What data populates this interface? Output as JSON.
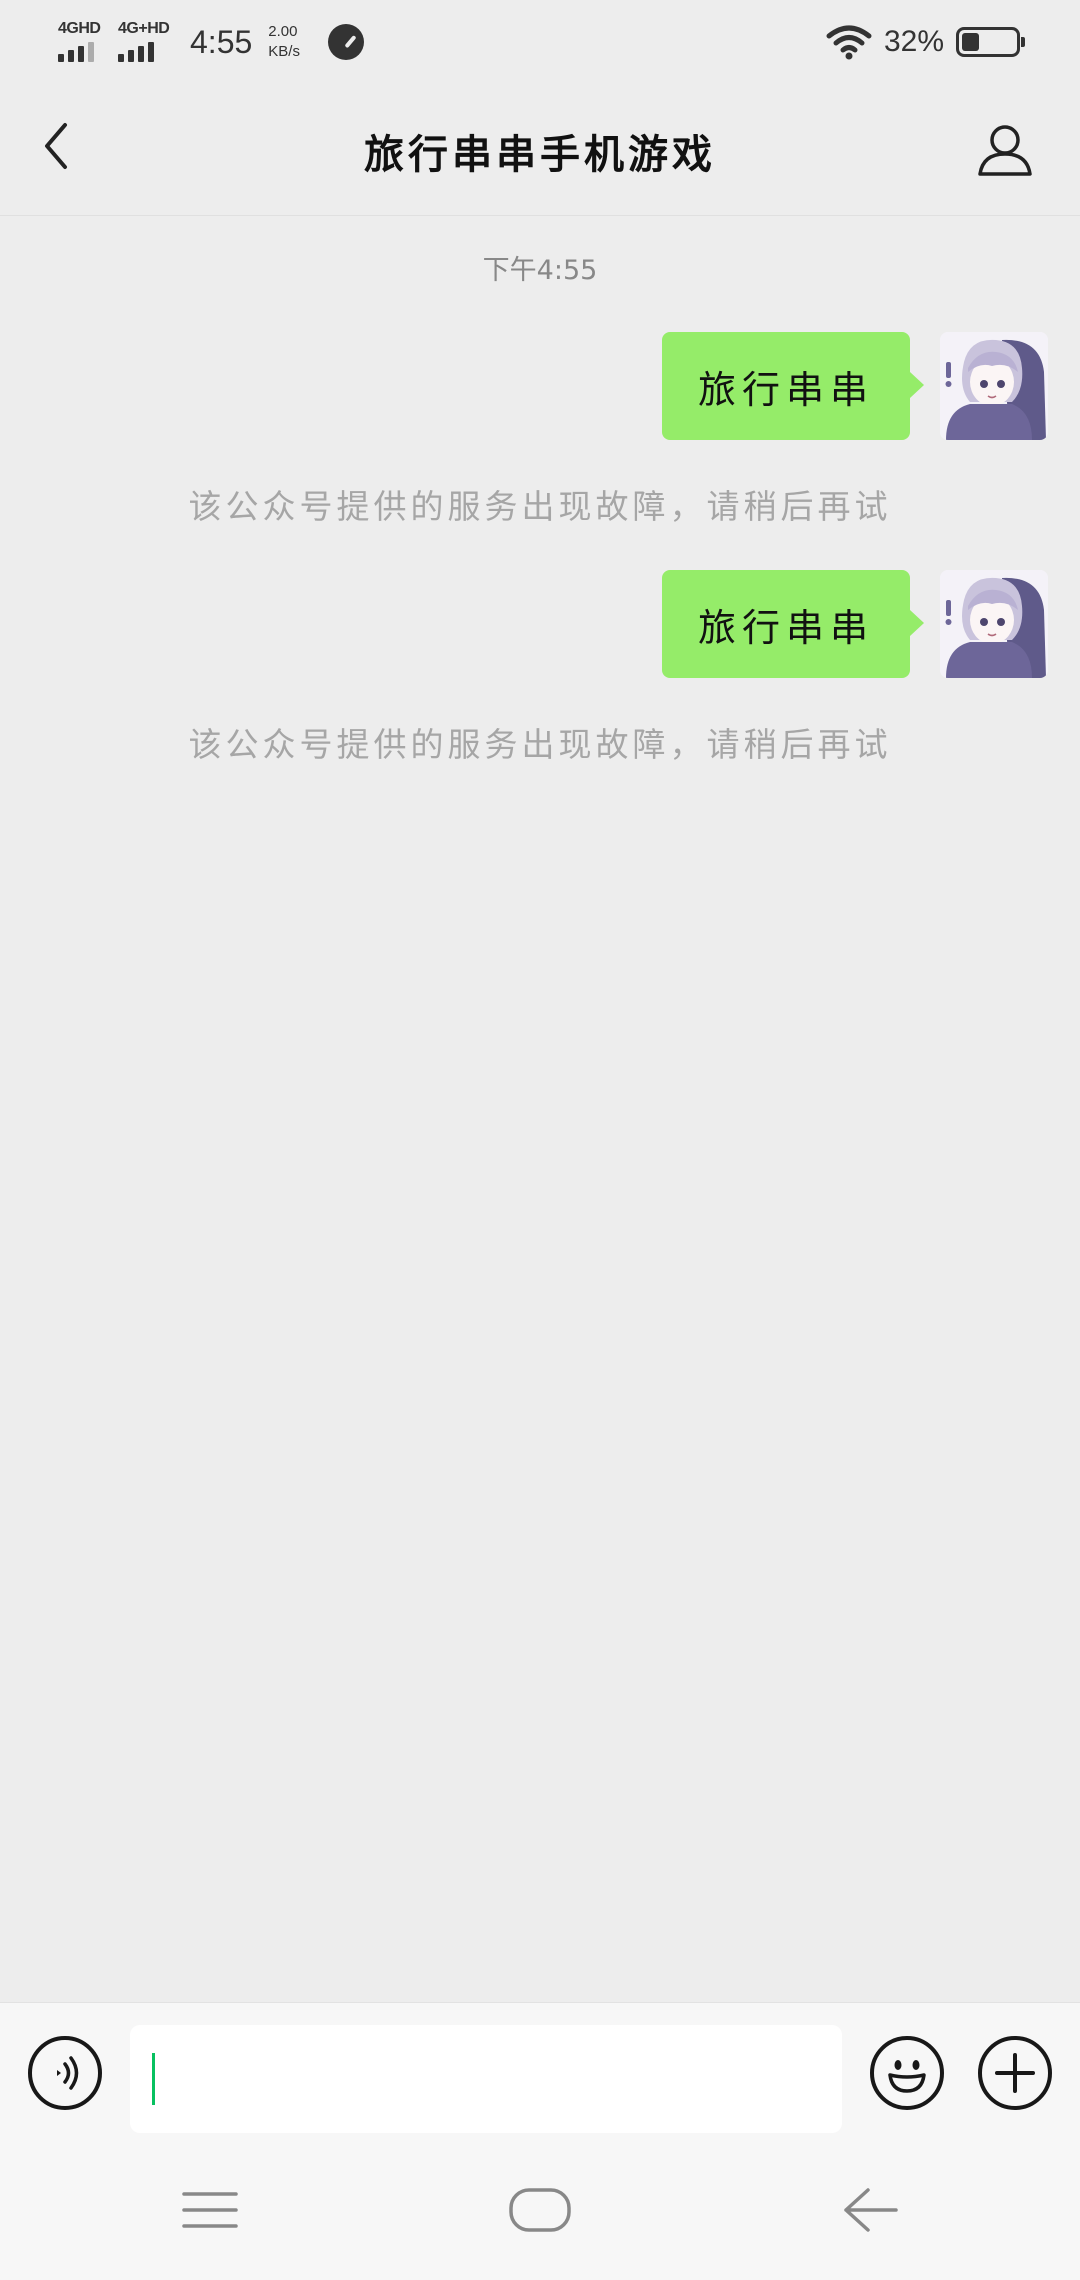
{
  "status_bar": {
    "signal_1_label": "4GHD",
    "signal_2_label": "4G+HD",
    "time": "4:55",
    "net_speed_value": "2.00",
    "net_speed_unit": "KB/s",
    "battery_percent": "32%",
    "battery_level": 0.32,
    "wifi_icon": "wifi-icon",
    "gauge_icon": "speed-gauge-icon"
  },
  "header": {
    "back_icon": "chevron-left-icon",
    "title": "旅行串串手机游戏",
    "profile_icon": "person-icon"
  },
  "chat": {
    "timestamp": "下午4:55",
    "messages": [
      {
        "text": "旅行串串",
        "sender": "self"
      },
      {
        "system_text": "该公众号提供的服务出现故障，请稍后再试"
      },
      {
        "text": "旅行串串",
        "sender": "self"
      },
      {
        "system_text": "该公众号提供的服务出现故障，请稍后再试"
      }
    ],
    "bubble_color": "#95ec69"
  },
  "input_bar": {
    "voice_icon": "voice-icon",
    "input_value": "",
    "emoji_icon": "smiley-icon",
    "plus_icon": "plus-icon",
    "caret_color": "#07c160"
  },
  "nav_bar": {
    "menu_icon": "menu-icon",
    "home_icon": "home-icon",
    "back_icon": "back-arrow-icon"
  }
}
